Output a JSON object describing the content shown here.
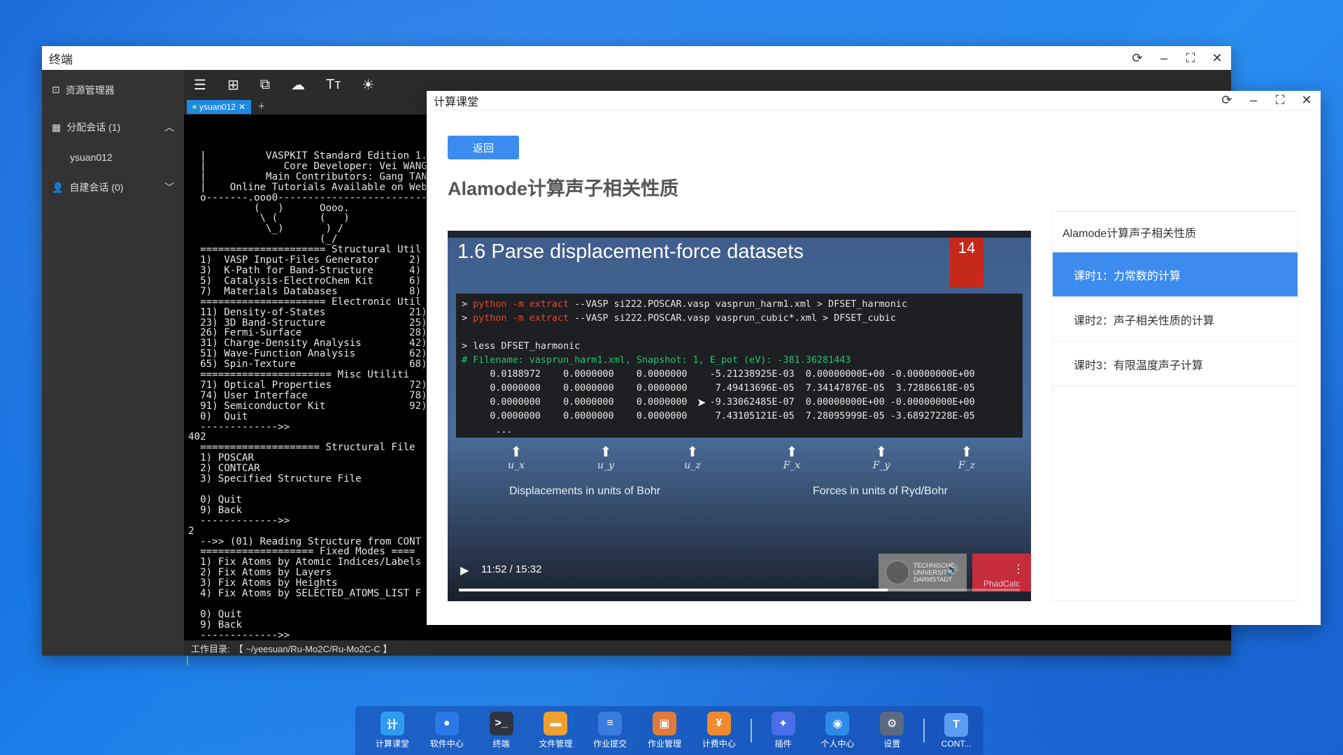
{
  "terminal_window": {
    "title": "终端",
    "sidebar": {
      "resource_manager": "资源管理器",
      "allocated_sessions": "分配会话 (1)",
      "session_user": "ysuan012",
      "custom_sessions": "自建会话 (0)"
    },
    "tab_label": "ysuan012",
    "status_label": "工作目录:",
    "status_path": "【 ~/yeesuan/Ru-Mo2C/Ru-Mo2C-C 】",
    "output": "  |          VASPKIT Standard Edition 1.\n  |             Core Developer: Vei WANG (w\n  |          Main Contributors: Gang TANG,\n  |    Online Tutorials Available on Webs\n  o-------.ooo0--------------------------\n           (   )      Oooo.\n            \\ (       (   )\n             \\_)       ) /\n                      (_/\n  ===================== Structural Util\n  1)  VASP Input-Files Generator     2)\n  3)  K-Path for Band-Structure      4)\n  5)  Catalysis-ElectroChem Kit      6)\n  7)  Materials Databases            8)\n  ===================== Electronic Util\n  11) Density-of-States              21)\n  23) 3D Band-Structure              25)\n  26) Fermi-Surface                  28)\n  31) Charge-Density Analysis        42)\n  51) Wave-Function Analysis         62)\n  65) Spin-Texture                   68)\n  ====================== Misc Utiliti\n  71) Optical Properties             72)\n  74) User Interface                 78)\n  91) Semiconductor Kit              92)\n  0)  Quit\n  ------------->>\n402\n  ==================== Structural File\n  1) POSCAR\n  2) CONTCAR\n  3) Specified Structure File\n\n  0) Quit\n  9) Back\n  ------------->>\n2\n  -->> (01) Reading Structure from CONT\n  =================== Fixed Modes ====\n  1) Fix Atoms by Atomic Indices/Labels\n  2) Fix Atoms by Layers\n  3) Fix Atoms by Heights\n  4) Fix Atoms by SELECTED_ATOMS_LIST F\n\n  0) Quit\n  9) Back\n  ------------->>"
  },
  "class_window": {
    "title": "计算课堂",
    "back_button": "返回",
    "course_title": "Alamode计算声子相关性质",
    "video": {
      "heading": "1.6 Parse displacement-force datasets",
      "slide_number": "14",
      "cmd1_prefix": "python -m extract",
      "cmd1_rest": " --VASP si222.POSCAR.vasp vasprun_harm1.xml > DFSET_harmonic",
      "cmd2_prefix": "python -m extract",
      "cmd2_rest": " --VASP si222.POSCAR.vasp vasprun_cubic*.xml > DFSET_cubic",
      "cmd3": "less DFSET_harmonic",
      "comment": "# Filename: vasprun_harm1.xml, Snapshot: 1, E_pot (eV): -381.36281443",
      "rows": [
        "0.0188972    0.0000000    0.0000000    -5.21238925E-03  0.00000000E+00 -0.00000000E+00",
        "0.0000000    0.0000000    0.0000000     7.49413696E-05  7.34147876E-05  3.72886618E-05",
        "0.0000000    0.0000000    0.0000000    -9.33062485E-07  0.00000000E+00 -0.00000000E+00",
        "0.0000000    0.0000000    0.0000000     7.43105121E-05  7.28095999E-05 -3.68927228E-05"
      ],
      "ellipsis": "...",
      "arrow_labels": [
        "u_x",
        "u_y",
        "u_z",
        "F_x",
        "F_y",
        "F_z"
      ],
      "caption_left": "Displacements in units of Bohr",
      "caption_right": "Forces in units of Ryd/Bohr",
      "time": "11:52 / 15:32",
      "progress": 0.764,
      "logo1_text": "TECHNISCHE UNIVERSITÄT DARMSTADT",
      "logo2_text": "PhadCalc"
    },
    "lesson_panel": {
      "title": "Alamode计算声子相关性质",
      "lessons": [
        "课时1：力常数的计算",
        "课时2：声子相关性质的计算",
        "课时3：有限温度声子计算"
      ]
    }
  },
  "dock": {
    "items": [
      {
        "label": "计算课堂",
        "icon": "classroom-icon",
        "color": "#2f9bf0",
        "glyph": "计"
      },
      {
        "label": "软件中心",
        "icon": "software-icon",
        "color": "#2a78e8",
        "glyph": "●"
      },
      {
        "label": "终端",
        "icon": "terminal-icon",
        "color": "#2e3440",
        "glyph": ">_"
      },
      {
        "label": "文件管理",
        "icon": "folder-icon",
        "color": "#f0a030",
        "glyph": "▬"
      },
      {
        "label": "作业提交",
        "icon": "submit-icon",
        "color": "#3a7be0",
        "glyph": "≡"
      },
      {
        "label": "作业管理",
        "icon": "job-icon",
        "color": "#e07a3a",
        "glyph": "▣"
      },
      {
        "label": "计费中心",
        "icon": "billing-icon",
        "color": "#f08a30",
        "glyph": "¥"
      },
      {
        "label": "插件",
        "icon": "plugin-icon",
        "color": "#4a6de8",
        "glyph": "✦"
      },
      {
        "label": "个人中心",
        "icon": "user-icon",
        "color": "#2f8ae8",
        "glyph": "◉"
      },
      {
        "label": "设置",
        "icon": "gear-icon",
        "color": "#5a6a80",
        "glyph": "⚙"
      },
      {
        "label": "CONT...",
        "icon": "cont-icon",
        "color": "#5b9cf0",
        "glyph": "T"
      }
    ]
  }
}
